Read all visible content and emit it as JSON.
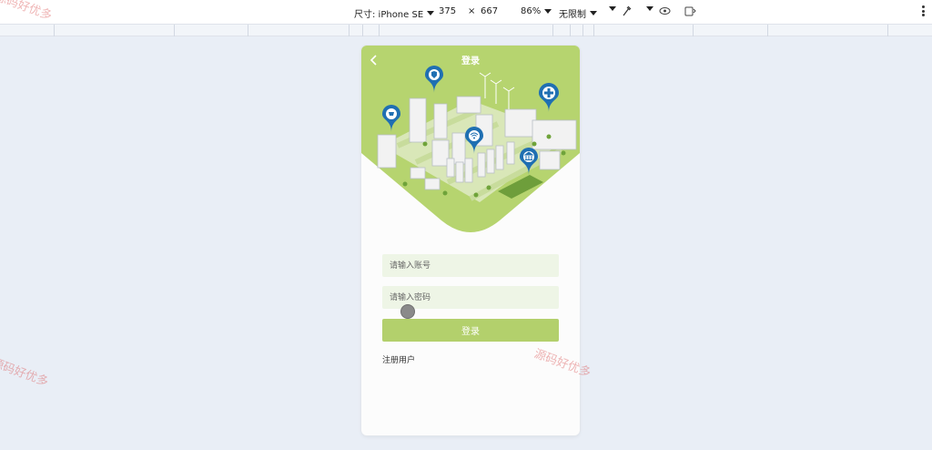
{
  "toolbar": {
    "dimensions_label": "尺寸: iPhone SE",
    "width": "375",
    "times": "×",
    "height": "667",
    "zoom": "86%",
    "throttle": "无限制"
  },
  "page": {
    "title": "登录",
    "username_placeholder": "请输入账号",
    "password_placeholder": "请输入密码",
    "login_label": "登录",
    "register_label": "注册用户"
  },
  "watermark": {
    "text": "源码好优多"
  },
  "colors": {
    "accent_green": "#b3d06c",
    "input_bg": "#eef5e6",
    "pin_blue": "#1f6fb2"
  }
}
